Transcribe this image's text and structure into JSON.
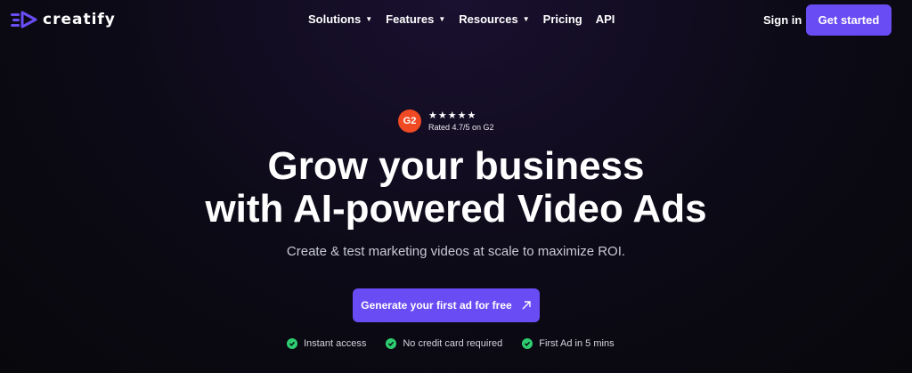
{
  "brand": {
    "name": "creatify",
    "color": "#6a4cf5"
  },
  "nav": {
    "items": [
      {
        "label": "Solutions",
        "dropdown": true
      },
      {
        "label": "Features",
        "dropdown": true
      },
      {
        "label": "Resources",
        "dropdown": true
      },
      {
        "label": "Pricing",
        "dropdown": false
      },
      {
        "label": "API",
        "dropdown": false
      }
    ],
    "sign_in": "Sign in",
    "get_started": "Get started"
  },
  "rating": {
    "badge": "G2",
    "stars": "★★★★★",
    "label": "Rated 4.7/5 on G2",
    "badge_color": "#ef4a23"
  },
  "hero": {
    "headline_line1": "Grow your business",
    "headline_line2": "with AI-powered Video Ads",
    "subtitle": "Create & test marketing videos at scale to maximize ROI.",
    "cta": "Generate your first ad for free"
  },
  "features": [
    {
      "label": "Instant access",
      "icon": "check-circle-icon"
    },
    {
      "label": "No credit card required",
      "icon": "check-circle-icon"
    },
    {
      "label": "First Ad in 5 mins",
      "icon": "check-circle-icon"
    }
  ],
  "colors": {
    "check": "#2ecc71",
    "background": "#0c0a16"
  }
}
